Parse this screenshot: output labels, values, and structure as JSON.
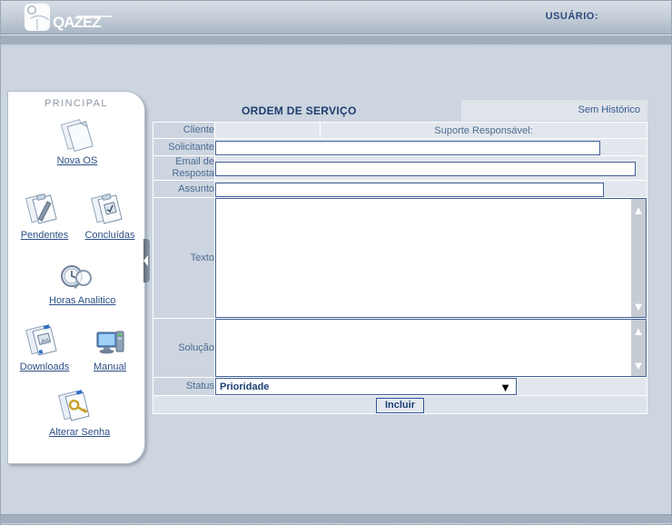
{
  "header": {
    "logo_text": "QAZEZ",
    "logo_icon": "person-building-logo-icon",
    "user_label": "USUÁRIO:"
  },
  "sidebar": {
    "title": "PRINCIPAL",
    "items": [
      {
        "label": "Nova OS",
        "icon": "documents-icon"
      },
      {
        "label": "Pendentes",
        "icon": "clipboard-pen-icon"
      },
      {
        "label": "Concluídas",
        "icon": "clipboard-check-icon"
      },
      {
        "label": "Horas Analitico",
        "icon": "clock-magnifier-icon"
      },
      {
        "label": "Downloads",
        "icon": "document-download-icon"
      },
      {
        "label": "Manual",
        "icon": "computer-monitor-icon"
      },
      {
        "label": "Alterar Senha",
        "icon": "document-keys-icon"
      }
    ]
  },
  "main": {
    "title": "ORDEM DE SERVIÇO",
    "history_tab": "Sem Histórico",
    "rows": {
      "cliente_label": "Cliente",
      "cliente_value": "",
      "suporte_label": "Suporte Responsável:",
      "solicitante_label": "Solicitante",
      "solicitante_value": "",
      "email_label": "Email de Resposta",
      "email_value": "",
      "assunto_label": "Assunto",
      "assunto_value": "",
      "texto_label": "Texto",
      "texto_value": "",
      "solucao_label": "Solução",
      "solucao_value": "",
      "status_label": "Status",
      "status_value": "Prioridade"
    },
    "submit_label": "Incluir"
  },
  "colors": {
    "page_bg": "#ccd5e0",
    "field_bg": "#e2e7ed",
    "label_text": "#4e6a92",
    "link": "#2d4f86",
    "title": "#1f3d6e",
    "border": "#3f6094"
  }
}
